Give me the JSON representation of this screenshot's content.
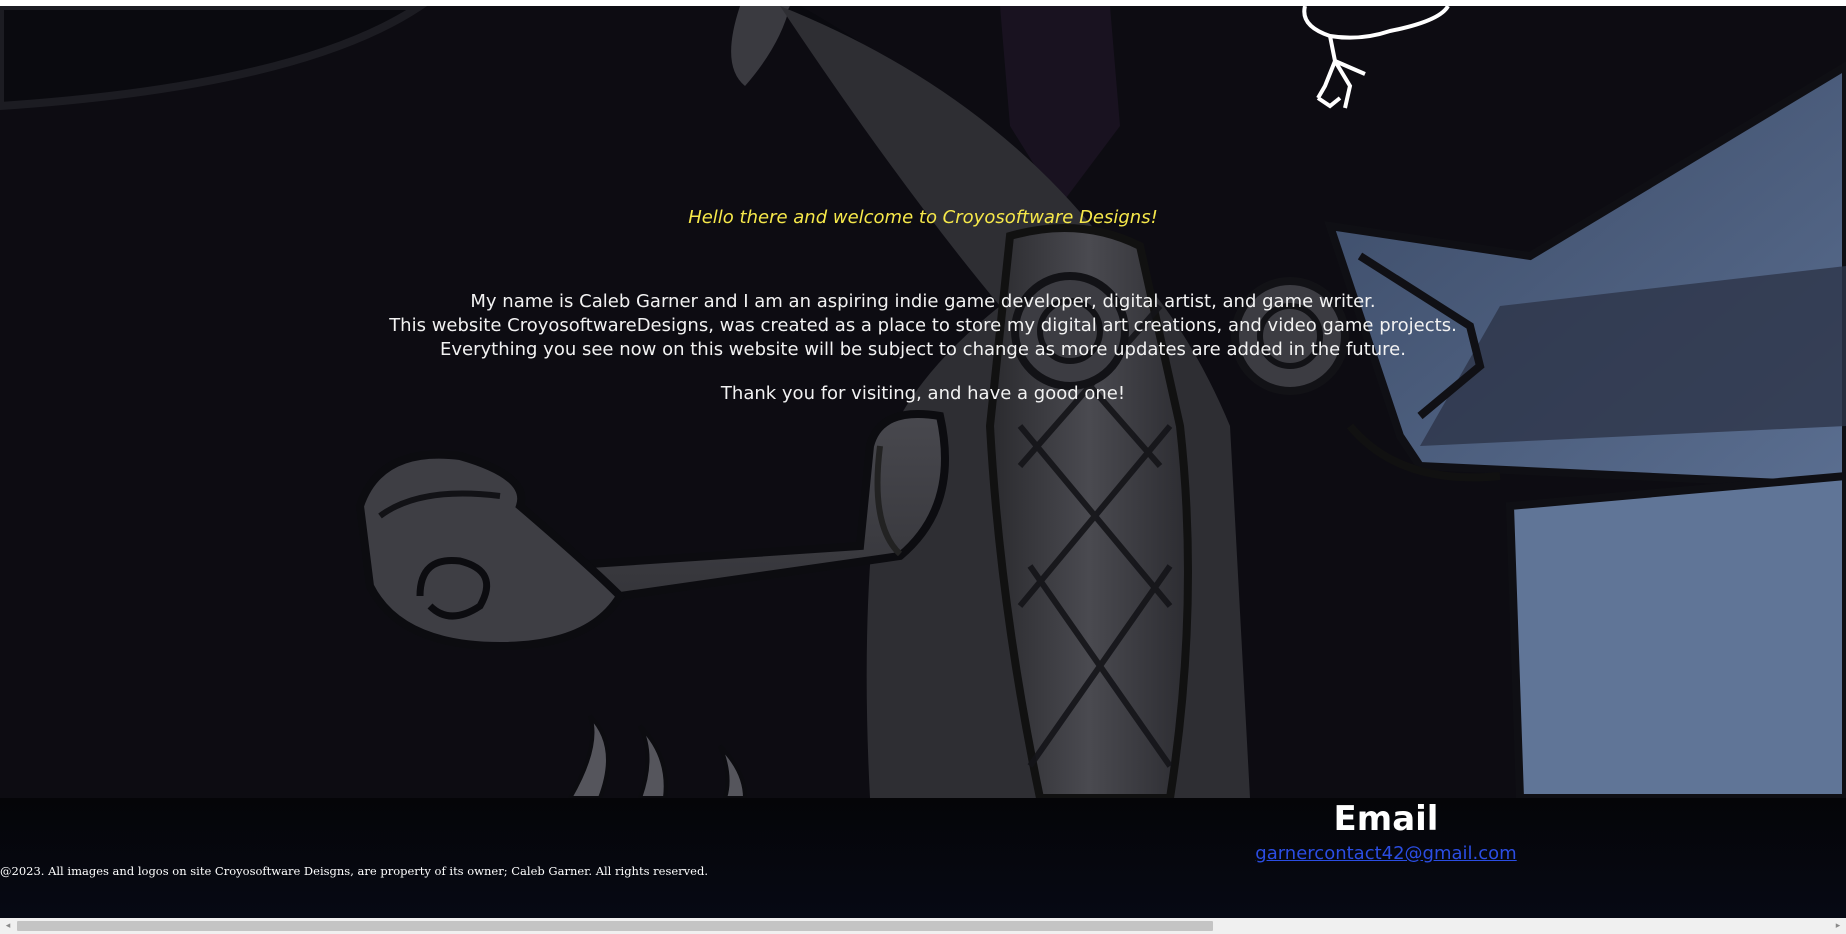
{
  "hero": {
    "welcome": "Hello there and welcome to Croyosoftware Designs!",
    "intro_lines": [
      "My name is Caleb Garner and I am an aspiring indie game developer, digital artist, and game writer.",
      "This website CroyosoftwareDesigns, was created as a place to store my digital art creations, and video game projects.",
      "Everything you see now on this website will be subject to change as more updates are added in the future."
    ],
    "thanks": "Thank you for visiting, and have a good one!"
  },
  "footer": {
    "email_heading": "Email",
    "email_address": "garnercontact42@gmail.com",
    "copyright": "@2023. All images and logos on site Croyosoftware Deisgns, are property of its owner; Caleb Garner. All rights reserved."
  },
  "scrollbar": {
    "left_arrow_icon": "◂",
    "right_arrow_icon": "▸",
    "scroll_position_fraction": 0.0,
    "visible_fraction": 0.66
  },
  "colors": {
    "welcome_text": "#f6e84a",
    "link": "#2b4de3",
    "background": "#0d0c12"
  }
}
